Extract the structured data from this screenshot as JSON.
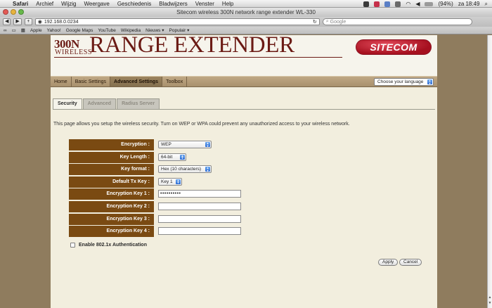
{
  "menubar": {
    "app": "Safari",
    "items": [
      "Archief",
      "Wijzig",
      "Weergave",
      "Geschiedenis",
      "Bladwijzers",
      "Venster",
      "Help"
    ],
    "battery": "(94%)",
    "clock": "za 18:49"
  },
  "window": {
    "title": "Sitecom wireless 300N network range extender WL-330"
  },
  "toolbar": {
    "address": "192.168.0.0234",
    "search_placeholder": "Google"
  },
  "bookmarks": [
    "Apple",
    "Yahoo!",
    "Google Maps",
    "YouTube",
    "Wikipedia",
    "Nieuws ▾",
    "Populair ▾"
  ],
  "header": {
    "logo_number": "300N",
    "logo_wireless": "WIRELESS",
    "logo_main": "RANGE EXTENDER",
    "brand": "SITECOM"
  },
  "nav": {
    "items": [
      "Home",
      "Basic Settings",
      "Advanced Settings",
      "Toolbox"
    ],
    "active_index": 2,
    "language_select": "Choose your language"
  },
  "tabs": {
    "items": [
      "Security",
      "Advanced",
      "Radius Server"
    ],
    "active_index": 0
  },
  "description": "This page allows you setup the wireless security. Turn on WEP or WPA could prevent any unauthorized access to your wireless network.",
  "form": {
    "encryption_label": "Encryption :",
    "encryption_value": "WEP",
    "key_length_label": "Key Length :",
    "key_length_value": "64-bit",
    "key_format_label": "Key format :",
    "key_format_value": "Hex (10 characters)",
    "default_tx_key_label": "Default Tx Key :",
    "default_tx_key_value": "Key 1",
    "key1_label": "Encryption Key 1 :",
    "key1_value": "••••••••••",
    "key2_label": "Encryption Key 2 :",
    "key2_value": "",
    "key3_label": "Encryption Key 3 :",
    "key3_value": "",
    "key4_label": "Encryption Key 4 :",
    "key4_value": "",
    "enable_8021x_label": "Enable 802.1x Authentication"
  },
  "buttons": {
    "apply": "Apply",
    "cancel": "Cancel"
  },
  "colors": {
    "label_brown": "#7a4a12",
    "logo_red": "#6b1b15",
    "brand_red": "#c01b2c",
    "page_bg": "#8f7c5e"
  }
}
